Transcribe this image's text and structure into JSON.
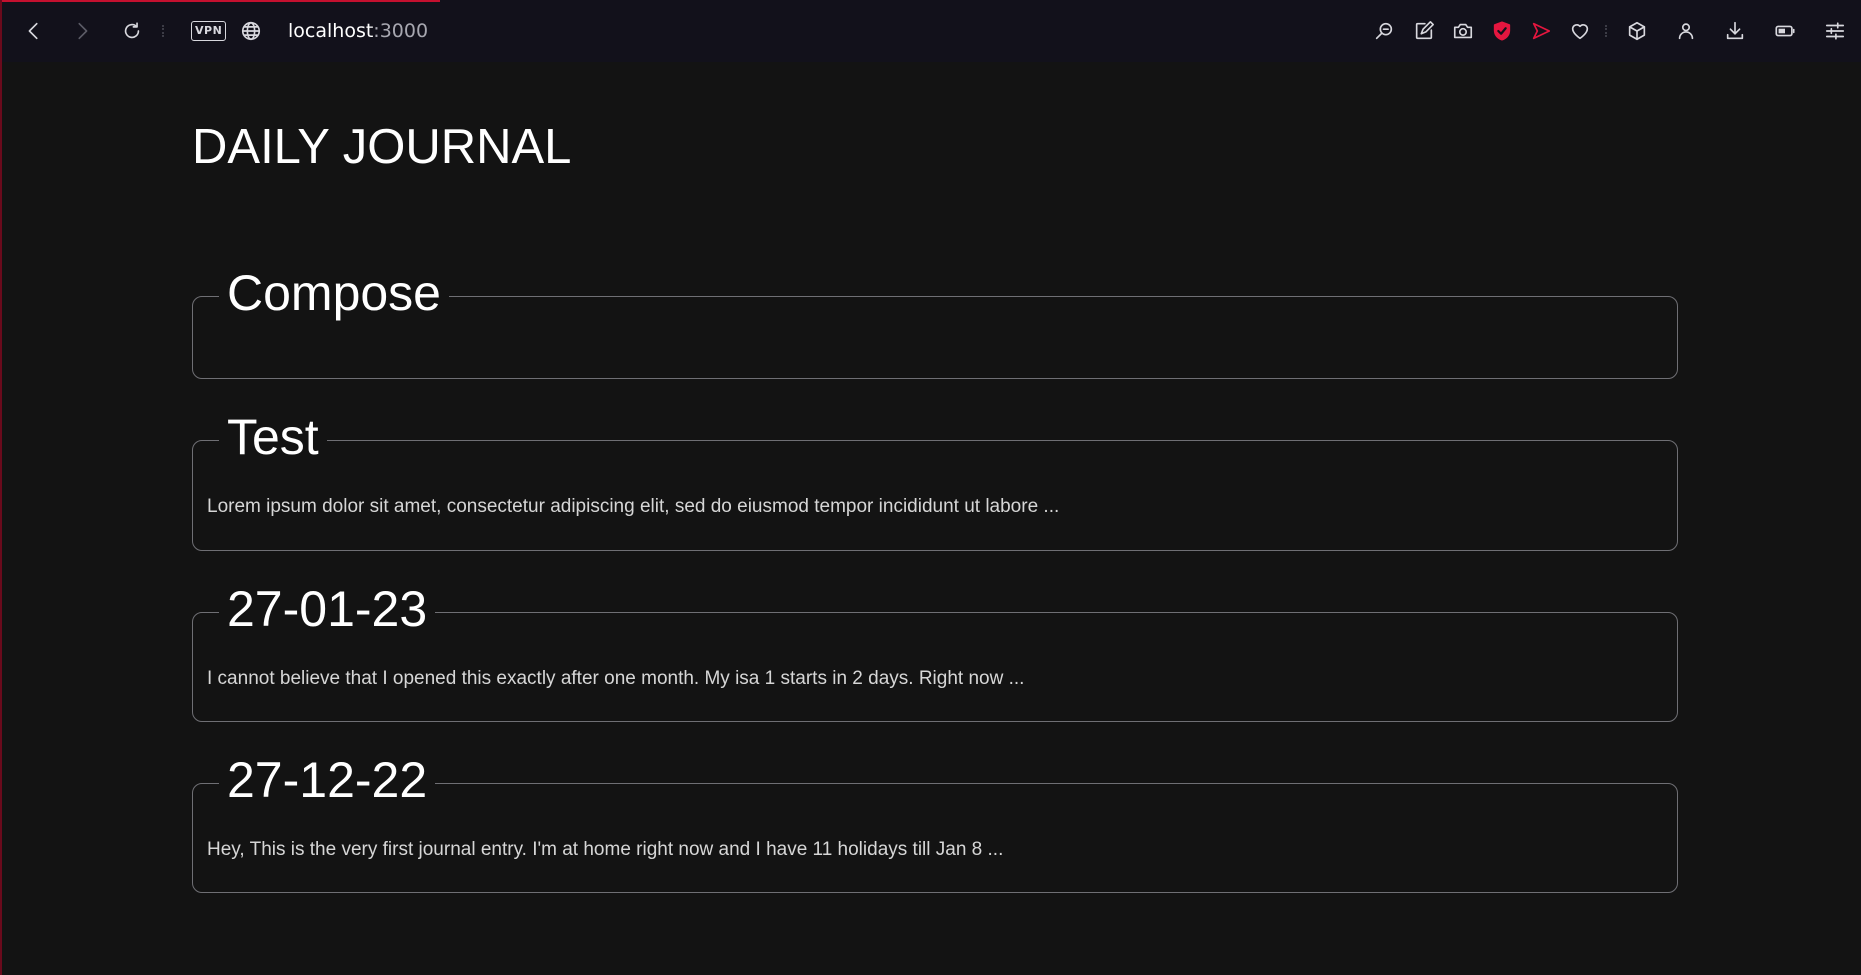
{
  "browser": {
    "url_host": "localhost",
    "url_port": ":3000",
    "vpn_label": "VPN",
    "accent_color": "#e5163f",
    "toolbar_icons": [
      "back-icon",
      "forward-icon",
      "reload-icon",
      "vpn-badge",
      "globe-icon",
      "search-page-icon",
      "snapshot-edit-icon",
      "camera-icon",
      "ad-block-shield-icon",
      "send-flow-icon",
      "heart-icon",
      "cube-icon",
      "profile-icon",
      "download-icon",
      "battery-saver-icon",
      "easy-setup-icon"
    ]
  },
  "page": {
    "title": "DAILY JOURNAL"
  },
  "compose": {
    "legend": "Compose"
  },
  "entries": [
    {
      "title": "Test",
      "excerpt": "Lorem ipsum dolor sit amet, consectetur adipiscing elit, sed do eiusmod tempor incididunt ut labore ..."
    },
    {
      "title": "27-01-23",
      "excerpt": "I cannot believe that I opened this exactly after one month. My isa 1 starts in 2 days. Right now ..."
    },
    {
      "title": "27-12-22",
      "excerpt": "Hey, This is the very first journal entry. I'm at home right now and I have 11 holidays till Jan 8 ..."
    }
  ]
}
